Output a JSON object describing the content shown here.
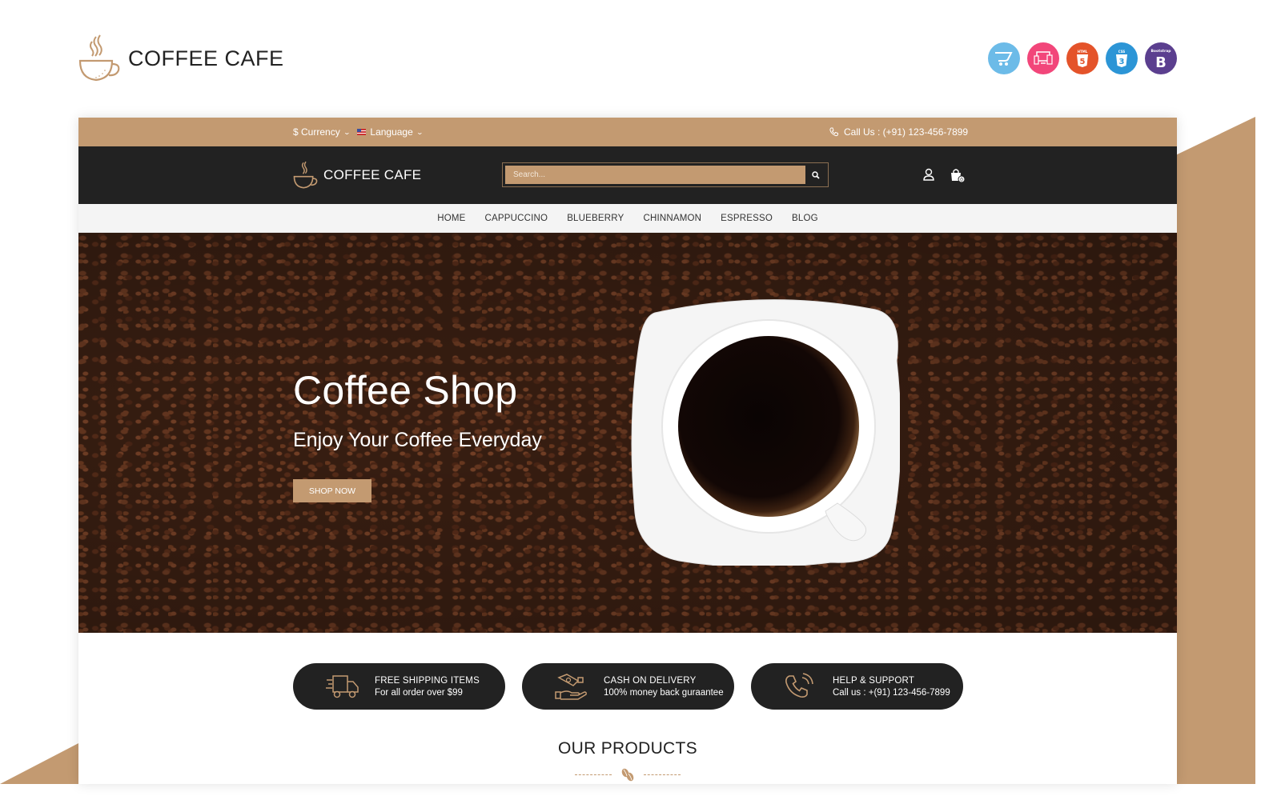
{
  "brand": {
    "name": "COFFEE CAFE",
    "logo_icon": "coffee-cup-icon"
  },
  "tech_badges": [
    {
      "name": "opencart-icon",
      "color": "#6cbbe8"
    },
    {
      "name": "responsive-icon",
      "color": "#f2467a"
    },
    {
      "name": "html5-icon",
      "label": "HTML",
      "color": "#e4532a"
    },
    {
      "name": "css3-icon",
      "label": "CSS",
      "color": "#2c95d6"
    },
    {
      "name": "bootstrap-icon",
      "label": "Bootstrap",
      "color": "#5b3f8f"
    }
  ],
  "topbar": {
    "currency_label": "$ Currency",
    "language_label": "Language",
    "call_label": "Call Us : (+91) 123-456-7899"
  },
  "header": {
    "logo_text": "COFFEE CAFE",
    "search_placeholder": "Search...",
    "cart_count": "0"
  },
  "nav": {
    "items": [
      "HOME",
      "CAPPUCCINO",
      "BLUEBERRY",
      "CHINNAMON",
      "ESPRESSO",
      "BLOG"
    ]
  },
  "hero": {
    "title": "Coffee Shop",
    "subtitle": "Enjoy Your Coffee Everyday",
    "button_label": "SHOP NOW"
  },
  "features": [
    {
      "icon": "delivery-truck-icon",
      "title": "FREE SHIPPING ITEMS",
      "desc": "For all order over $99"
    },
    {
      "icon": "cash-handshake-icon",
      "title": "CASH ON DELIVERY",
      "desc": "100% money back guraantee"
    },
    {
      "icon": "phone-support-icon",
      "title": "HELP & SUPPORT",
      "desc": "Call us : +(91) 123-456-7899"
    }
  ],
  "products_section": {
    "title": "OUR PRODUCTS",
    "divider_icon": "coffee-bean-icon"
  },
  "colors": {
    "accent": "#c39a71",
    "dark": "#222222",
    "nav_bg": "#f4f4f4"
  }
}
